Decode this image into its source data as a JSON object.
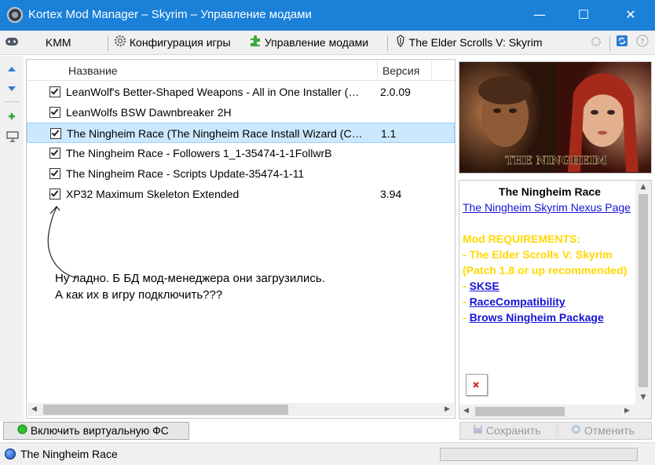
{
  "window": {
    "title": "Kortex Mod Manager – Skyrim – Управление модами",
    "minimize_glyph": "—",
    "maximize_glyph": "☐",
    "close_glyph": "✕"
  },
  "toolbar": {
    "kmm_label": "KMM",
    "config_label": "Конфигурация игры",
    "mods_label": "Управление модами",
    "game_label": "The Elder Scrolls V: Skyrim"
  },
  "mod_list": {
    "columns": [
      "Название",
      "Версия"
    ],
    "rows": [
      {
        "name": "LeanWolf's Better-Shaped Weapons - All in One Installer (…",
        "version": "2.0.09",
        "checked": true
      },
      {
        "name": "LeanWolfs BSW Dawnbreaker 2H",
        "version": "",
        "checked": true
      },
      {
        "name": "The Ningheim Race (The Ningheim Race Install Wizard (C…",
        "version": "1.1",
        "checked": true
      },
      {
        "name": "The Ningheim Race - Followers 1_1-35474-1-1FollwrB",
        "version": "",
        "checked": true
      },
      {
        "name": "The Ningheim Race - Scripts Update-35474-1-11",
        "version": "",
        "checked": true
      },
      {
        "name": "XP32 Maximum Skeleton Extended",
        "version": "3.94",
        "checked": true
      }
    ],
    "selected_index": 2
  },
  "annotation": {
    "line1": "Ну ладно. Б БД мод-менеджера они загрузились.",
    "line2": "А как их в игру подключить???"
  },
  "preview": {
    "caption": "THE NINGHEIM"
  },
  "description": {
    "title": "The Ningheim Race",
    "nexus_link": "The Ningheim Skyrim Nexus Page",
    "req_header": "Mod REQUIREMENTS:",
    "req_game": "- The Elder Scrolls V: Skyrim (Patch 1.8 or up recommended)",
    "requirements": [
      "SKSE",
      "RaceCompatibility",
      "Brows Ningheim Package"
    ],
    "dash": "-"
  },
  "buttons": {
    "vfs": "Включить виртуальную ФС",
    "save": "Сохранить",
    "cancel": "Отменить"
  },
  "status": {
    "text": "The Ningheim Race",
    "progress": 0
  },
  "colors": {
    "titlebar": "#1a80d8",
    "selection": "#cce8ff",
    "requirement_text": "#ffd800",
    "link": "#1515d6"
  }
}
